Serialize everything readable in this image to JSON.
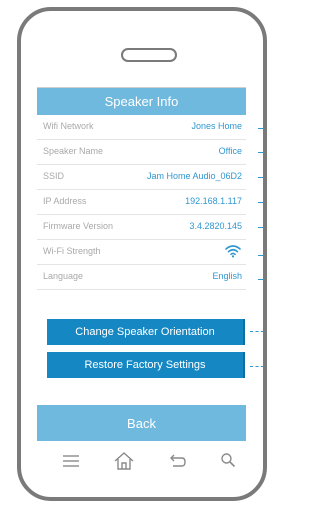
{
  "header": {
    "title": "Speaker Info"
  },
  "rows": [
    {
      "label": "Wifi Network",
      "value": "Jones Home"
    },
    {
      "label": "Speaker Name",
      "value": "Office"
    },
    {
      "label": "SSID",
      "value": "Jam Home Audio_06D2"
    },
    {
      "label": "IP Address",
      "value": "192.168.1.117"
    },
    {
      "label": "Firmware Version",
      "value": "3.4.2820.145"
    },
    {
      "label": "Wi-Fi Strength",
      "icon": "wifi-icon"
    },
    {
      "label": "Language",
      "value": "English"
    }
  ],
  "actions": {
    "change_orientation": "Change Speaker Orientation",
    "restore_factory": "Restore Factory Settings"
  },
  "footer": {
    "back_label": "Back"
  },
  "nav_icons": [
    "menu-icon",
    "home-icon",
    "back-arrow-icon",
    "search-icon"
  ],
  "colors": {
    "accent_light": "#6fb9df",
    "accent_dark": "#1588c4",
    "value_text": "#2f97d1",
    "label_text": "#a9a9a9",
    "frame": "#7a7a7a"
  }
}
